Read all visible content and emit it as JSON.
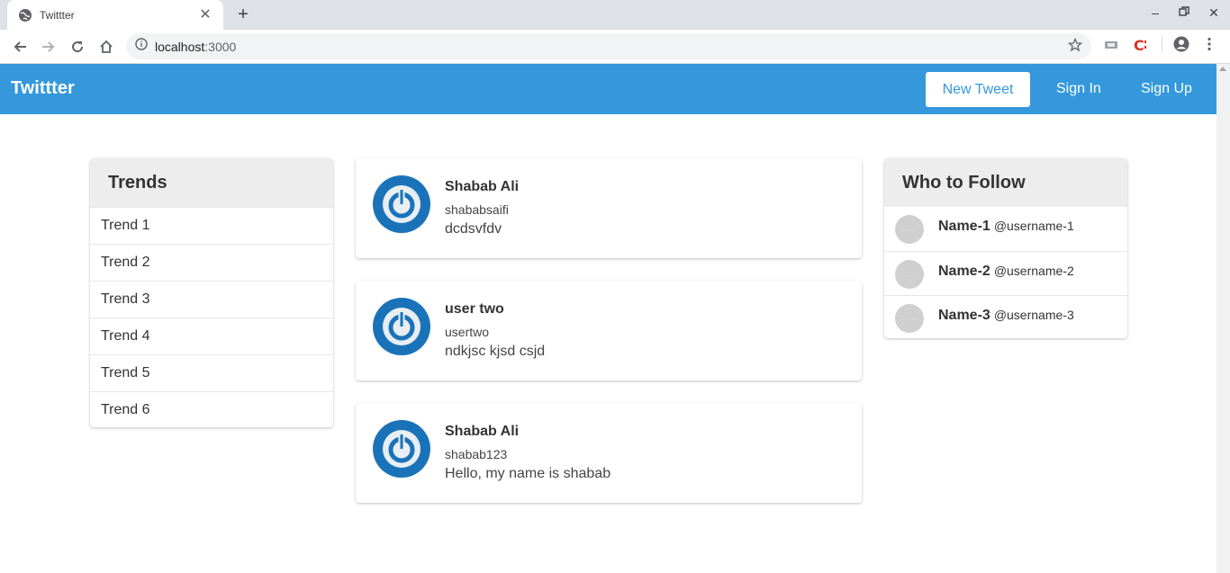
{
  "browser": {
    "tab_title": "Twittter",
    "url_host": "localhost",
    "url_port": ":3000"
  },
  "navbar": {
    "brand": "Twittter",
    "new_tweet": "New Tweet",
    "sign_in": "Sign In",
    "sign_up": "Sign Up",
    "color": "#3498db"
  },
  "trends": {
    "title": "Trends",
    "items": [
      "Trend 1",
      "Trend 2",
      "Trend 3",
      "Trend 4",
      "Trend 5",
      "Trend 6"
    ]
  },
  "tweets": [
    {
      "name": "Shabab Ali",
      "handle": "shababsaifi",
      "text": "dcdsvfdv"
    },
    {
      "name": "user two",
      "handle": "usertwo",
      "text": "ndkjsc kjsd csjd"
    },
    {
      "name": "Shabab Ali",
      "handle": "shabab123",
      "text": "Hello, my name is shabab"
    }
  ],
  "follow": {
    "title": "Who to Follow",
    "items": [
      {
        "name": "Name-1",
        "username": "@username-1",
        "avatar_text": "....."
      },
      {
        "name": "Name-2",
        "username": "@username-2",
        "avatar_text": "....."
      },
      {
        "name": "Name-3",
        "username": "@username-3",
        "avatar_text": "....."
      }
    ]
  },
  "icons": {
    "favicon": "globe-icon",
    "back": "arrow-left-icon",
    "forward": "arrow-right-icon",
    "reload": "reload-icon",
    "home": "home-icon",
    "info": "info-icon",
    "bookmark": "star-icon",
    "profile": "account-circle-icon",
    "menu": "kebab-menu-icon",
    "tweet_avatar": "power-icon"
  }
}
